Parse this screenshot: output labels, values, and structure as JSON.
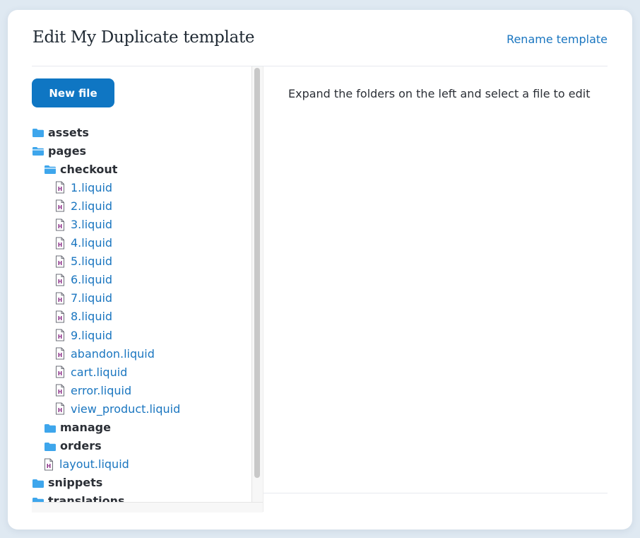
{
  "header": {
    "title": "Edit My Duplicate template",
    "rename_label": "Rename template"
  },
  "sidebar": {
    "new_file_label": "New file",
    "tree": [
      {
        "type": "folder",
        "level": 0,
        "label": "assets",
        "icon": "folder-icon"
      },
      {
        "type": "folder",
        "level": 0,
        "label": "pages",
        "icon": "folder-open-icon"
      },
      {
        "type": "folder",
        "level": 1,
        "label": "checkout",
        "icon": "folder-open-icon"
      },
      {
        "type": "file",
        "level": 2,
        "label": "1.liquid",
        "icon": "html-file-icon"
      },
      {
        "type": "file",
        "level": 2,
        "label": "2.liquid",
        "icon": "html-file-icon"
      },
      {
        "type": "file",
        "level": 2,
        "label": "3.liquid",
        "icon": "html-file-icon"
      },
      {
        "type": "file",
        "level": 2,
        "label": "4.liquid",
        "icon": "html-file-icon"
      },
      {
        "type": "file",
        "level": 2,
        "label": "5.liquid",
        "icon": "html-file-icon"
      },
      {
        "type": "file",
        "level": 2,
        "label": "6.liquid",
        "icon": "html-file-icon"
      },
      {
        "type": "file",
        "level": 2,
        "label": "7.liquid",
        "icon": "html-file-icon"
      },
      {
        "type": "file",
        "level": 2,
        "label": "8.liquid",
        "icon": "html-file-icon"
      },
      {
        "type": "file",
        "level": 2,
        "label": "9.liquid",
        "icon": "html-file-icon"
      },
      {
        "type": "file",
        "level": 2,
        "label": "abandon.liquid",
        "icon": "html-file-icon"
      },
      {
        "type": "file",
        "level": 2,
        "label": "cart.liquid",
        "icon": "html-file-icon"
      },
      {
        "type": "file",
        "level": 2,
        "label": "error.liquid",
        "icon": "html-file-icon"
      },
      {
        "type": "file",
        "level": 2,
        "label": "view_product.liquid",
        "icon": "html-file-icon"
      },
      {
        "type": "folder",
        "level": 1,
        "label": "manage",
        "icon": "folder-icon"
      },
      {
        "type": "folder",
        "level": 1,
        "label": "orders",
        "icon": "folder-icon"
      },
      {
        "type": "file",
        "level": 1,
        "label": "layout.liquid",
        "icon": "html-file-icon"
      },
      {
        "type": "folder",
        "level": 0,
        "label": "snippets",
        "icon": "folder-icon"
      },
      {
        "type": "folder",
        "level": 0,
        "label": "translations",
        "icon": "folder-icon"
      }
    ]
  },
  "editor": {
    "placeholder_text": "Expand the folders on the left and select a file to edit"
  },
  "colors": {
    "accent": "#0f76c3",
    "link": "#1a76c0",
    "folder": "#3ea6ec",
    "file_icon_letter": "#8a2a86",
    "background": "#dfe9f2"
  }
}
